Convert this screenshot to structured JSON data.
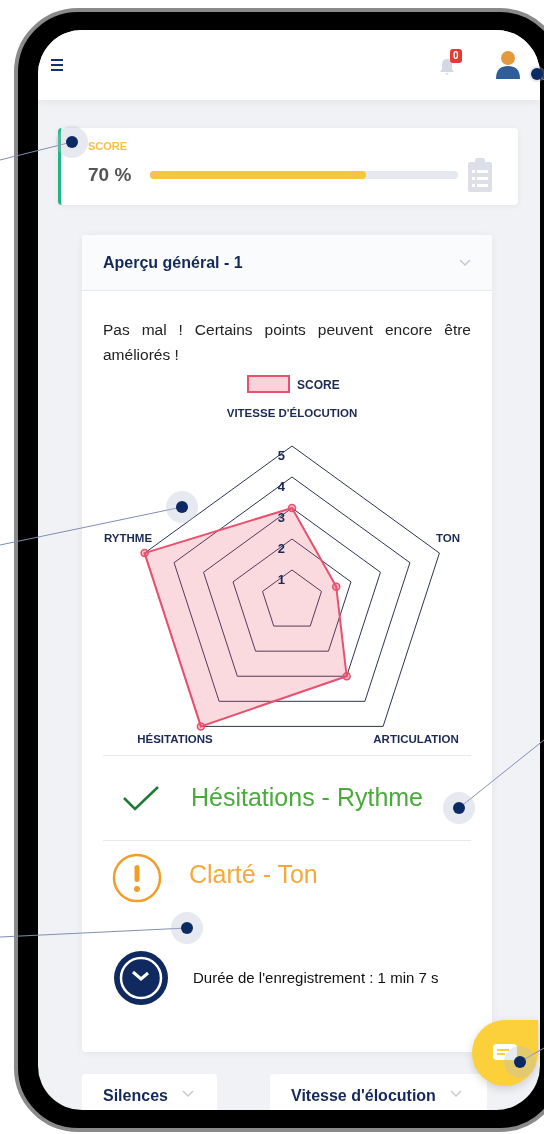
{
  "header": {
    "notification_count": "0"
  },
  "score_card": {
    "label": "SCORE",
    "value": "70 %",
    "level": 0.7
  },
  "overview": {
    "title": "Aperçu général - 1",
    "message": "Pas mal ! Certains points peuvent encore être améliorés !",
    "chart_data": {
      "type": "radar",
      "categories": [
        "VITESSE D'ÉLOCUTION",
        "TON",
        "ARTICULATION",
        "HÉSITATIONS",
        "RYTHME"
      ],
      "series": [
        {
          "name": "SCORE",
          "color": "#e8506e",
          "values": [
            3,
            1.5,
            3,
            5,
            5
          ]
        }
      ],
      "ylim": [
        0,
        5
      ],
      "yticks": [
        1,
        2,
        3,
        4,
        5
      ]
    },
    "results": [
      {
        "kind": "success",
        "text": "Hésitations - Rythme"
      },
      {
        "kind": "warning",
        "text": "Clarté - Ton"
      }
    ],
    "duration": "Durée de l'enregistrement : 1 min 7 s"
  },
  "sections": [
    {
      "title": "Silences"
    },
    {
      "title": "Vitesse d'élocution"
    }
  ]
}
